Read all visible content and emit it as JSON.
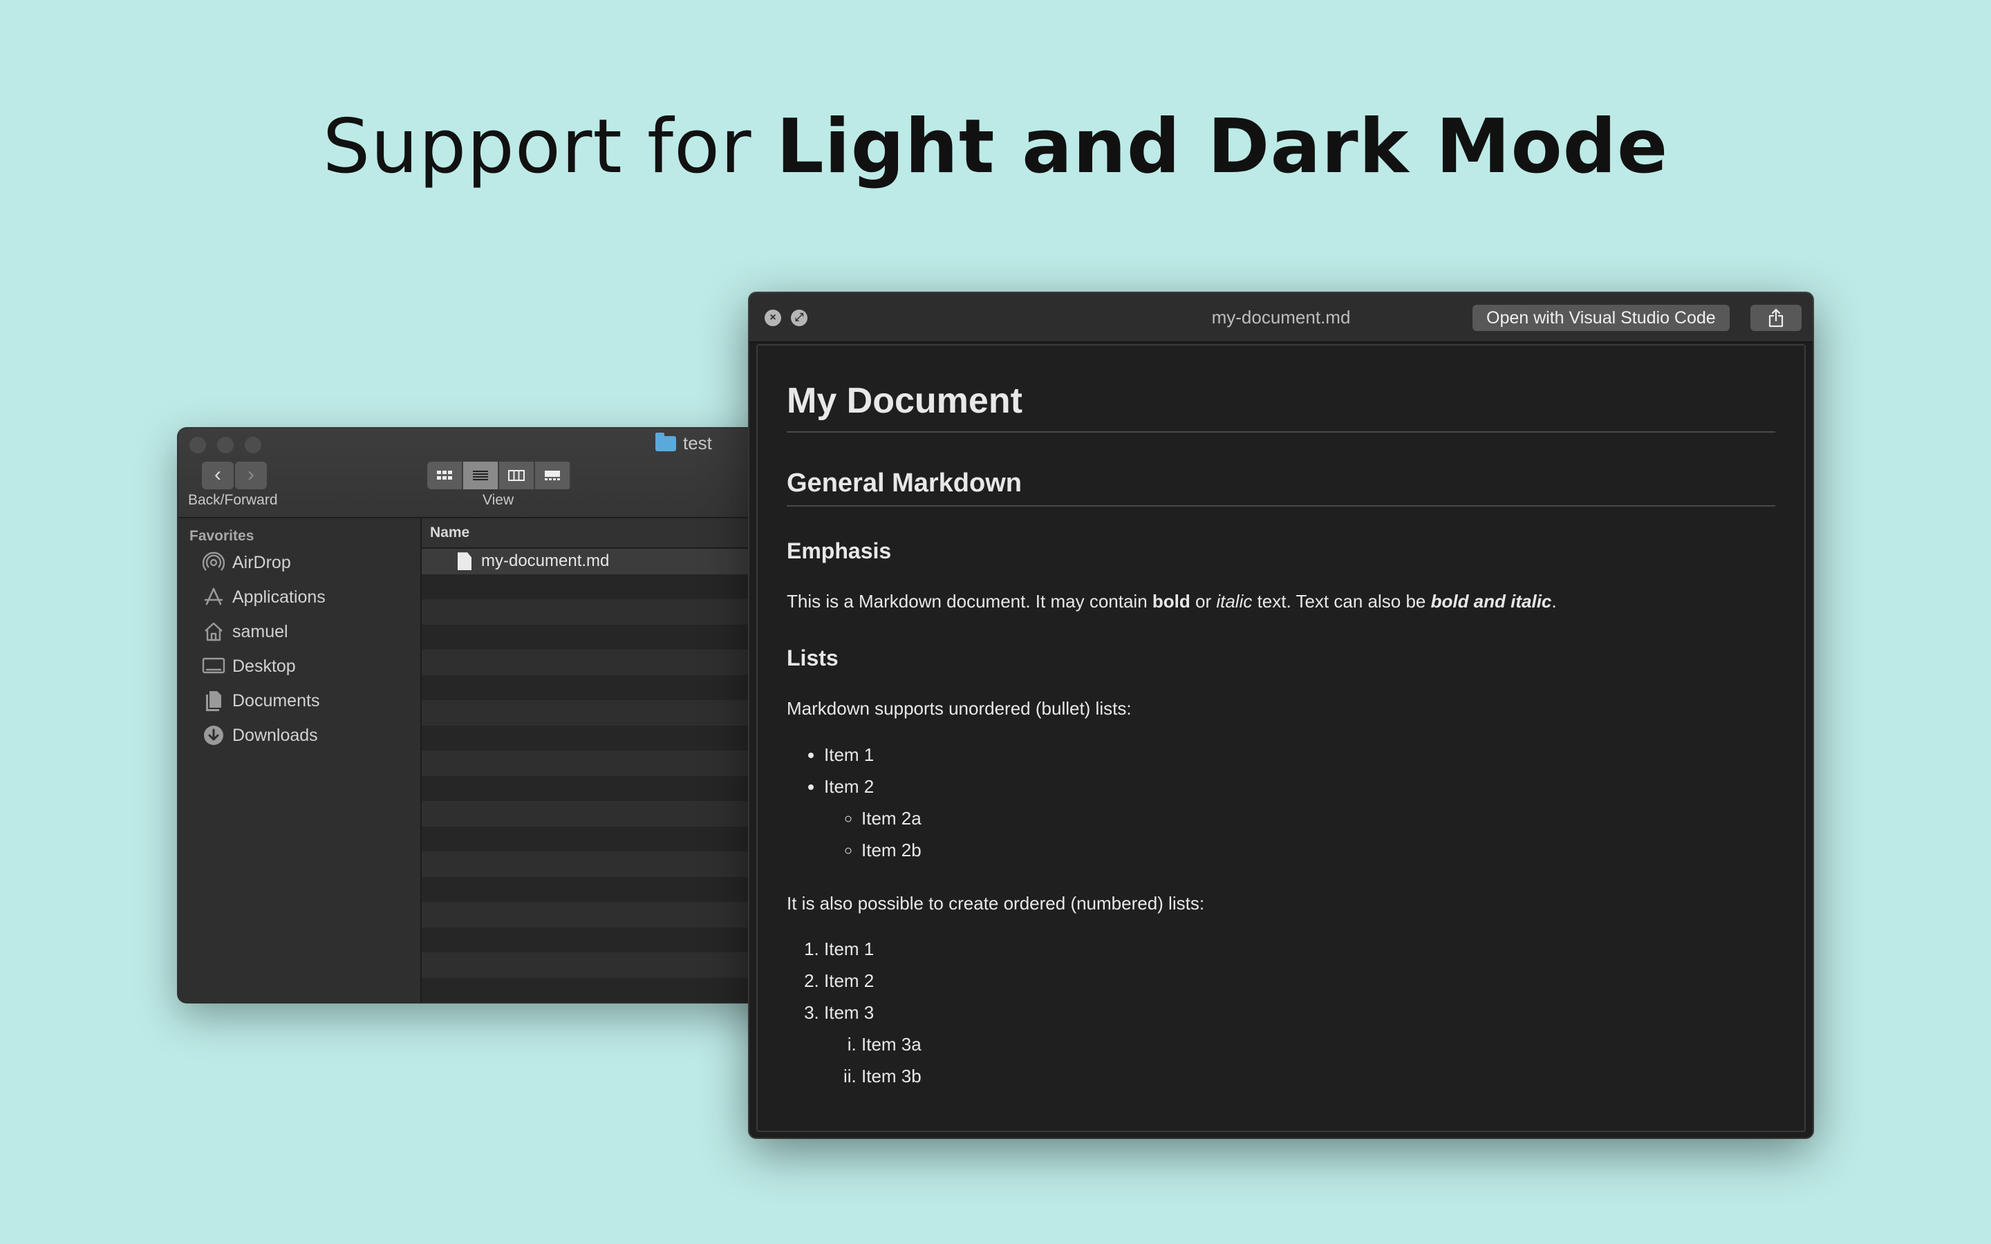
{
  "headline": {
    "regular": "Support for ",
    "bold": "Light and Dark Mode"
  },
  "finder": {
    "title": "test",
    "back_forward_label": "Back/Forward",
    "view_label": "View",
    "sidebar": {
      "heading": "Favorites",
      "items": [
        {
          "label": "AirDrop",
          "icon": "airdrop-icon"
        },
        {
          "label": "Applications",
          "icon": "applications-icon"
        },
        {
          "label": "samuel",
          "icon": "home-icon"
        },
        {
          "label": "Desktop",
          "icon": "desktop-icon"
        },
        {
          "label": "Documents",
          "icon": "documents-icon"
        },
        {
          "label": "Downloads",
          "icon": "downloads-icon"
        }
      ]
    },
    "list": {
      "column_name": "Name",
      "files": [
        "my-document.md"
      ]
    }
  },
  "quicklook": {
    "title": "my-document.md",
    "open_button": "Open with Visual Studio Code",
    "content": {
      "h1": "My Document",
      "h2": "General Markdown",
      "emphasis_heading": "Emphasis",
      "emphasis": {
        "t1": "This is a Markdown document. It may contain ",
        "bold": "bold",
        "t2": " or ",
        "italic": "italic",
        "t3": " text. Text can also be ",
        "bold_italic": "bold and italic",
        "t4": "."
      },
      "lists_heading": "Lists",
      "unordered_intro": "Markdown supports unordered (bullet) lists:",
      "unordered": {
        "item1": "Item 1",
        "item2": "Item 2",
        "item2a": "Item 2a",
        "item2b": "Item 2b"
      },
      "ordered_intro": "It is also possible to create ordered (numbered) lists:",
      "ordered": {
        "item1": "Item 1",
        "item2": "Item 2",
        "item3": "Item 3",
        "item3a": "Item 3a",
        "item3b": "Item 3b"
      }
    }
  },
  "colors": {
    "background": "#bdeae6",
    "window_dark": "#1e1e1e"
  }
}
